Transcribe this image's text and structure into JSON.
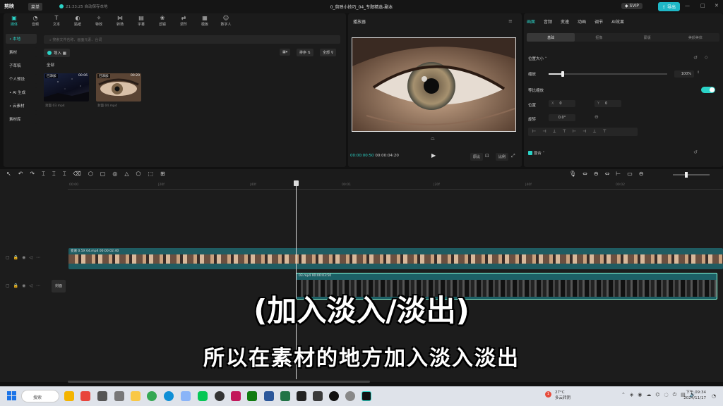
{
  "app": {
    "logo": "剪映",
    "menu_label": "菜单",
    "autosave": "21:33:25 自动保存本地",
    "doc_title": "0_剪映小技巧_04_专题精选-副本",
    "svip": "SVIP",
    "export_label": "导出",
    "win_controls": [
      "—",
      "□",
      "✕"
    ]
  },
  "toolbar": {
    "items": [
      {
        "label": "媒体",
        "icon": "media-icon",
        "active": true
      },
      {
        "label": "音频",
        "icon": "audio-icon"
      },
      {
        "label": "文本",
        "icon": "text-icon"
      },
      {
        "label": "贴纸",
        "icon": "sticker-icon"
      },
      {
        "label": "特效",
        "icon": "effects-icon"
      },
      {
        "label": "转场",
        "icon": "transition-icon"
      },
      {
        "label": "字幕",
        "icon": "subtitle-icon"
      },
      {
        "label": "滤镜",
        "icon": "filter-icon"
      },
      {
        "label": "调节",
        "icon": "adjust-icon"
      },
      {
        "label": "模板",
        "icon": "template-icon"
      },
      {
        "label": "数字人",
        "icon": "avatar-icon"
      }
    ]
  },
  "sidebar": {
    "items": [
      {
        "label": "• 本地",
        "active": true
      },
      {
        "label": "素材"
      },
      {
        "label": "子草稿"
      },
      {
        "label": "个人预设"
      },
      {
        "label": "• AI 生成"
      },
      {
        "label": "• 云素材"
      },
      {
        "label": "素材库"
      }
    ]
  },
  "media": {
    "search_placeholder": "搜索文件名称、画面元素、台词",
    "import_label": "导入",
    "all_label": "全部",
    "sort_label": "排序",
    "filter_label": "全部",
    "clips": [
      {
        "badge": "已添加",
        "duration": "00:06",
        "name": "03.mp4",
        "tag": "封面"
      },
      {
        "badge": "已添加",
        "duration": "00:20",
        "name": "04.mp4",
        "tag": "封面"
      }
    ]
  },
  "player": {
    "title": "播放器",
    "current_time": "00:00:00:50",
    "total_time": "00:00:04:20",
    "ratio_btn": "原比",
    "ratio2_btn": "比例"
  },
  "properties": {
    "tabs": [
      "画面",
      "音频",
      "变速",
      "动画",
      "调节",
      "AI效果"
    ],
    "active_tab": "画面",
    "subtabs": [
      "基础",
      "抠像",
      "蒙版",
      "美颜美体"
    ],
    "active_subtab": "基础",
    "section_position_size": "位置大小",
    "scale_label": "缩放",
    "scale_value": "100%",
    "scale_fraction": 0.12,
    "uniform_scale_label": "等比缩放",
    "position_label": "位置",
    "pos_x_label": "X",
    "pos_x": "0",
    "pos_y_label": "Y",
    "pos_y": "0",
    "rotate_label": "旋转",
    "rotate_value": "0.0°",
    "blend_label": "混合"
  },
  "timeline": {
    "ruler_ticks": [
      "00:00",
      "|20f",
      "|40f",
      "00:01",
      "|20f",
      "|40f",
      "00:02"
    ],
    "track1_label": "变速 0.5X  04.mp4  00:00:02:40",
    "track2_label": "03.mp4  00:00:03:50",
    "cover_label": "封面"
  },
  "captions": {
    "line1": "(加入淡入/淡出)",
    "line2": "所以在素材的地方加入淡入淡出"
  },
  "taskbar": {
    "search_label": "搜索",
    "weather_temp": "27°C",
    "weather_desc": "多云转阴",
    "weather_badge": "1",
    "time": "下午 09:34",
    "date": "2024/11/17"
  },
  "colors": {
    "accent": "#2bd3c7",
    "export": "#1fb8c7",
    "track": "#1f5c62"
  }
}
